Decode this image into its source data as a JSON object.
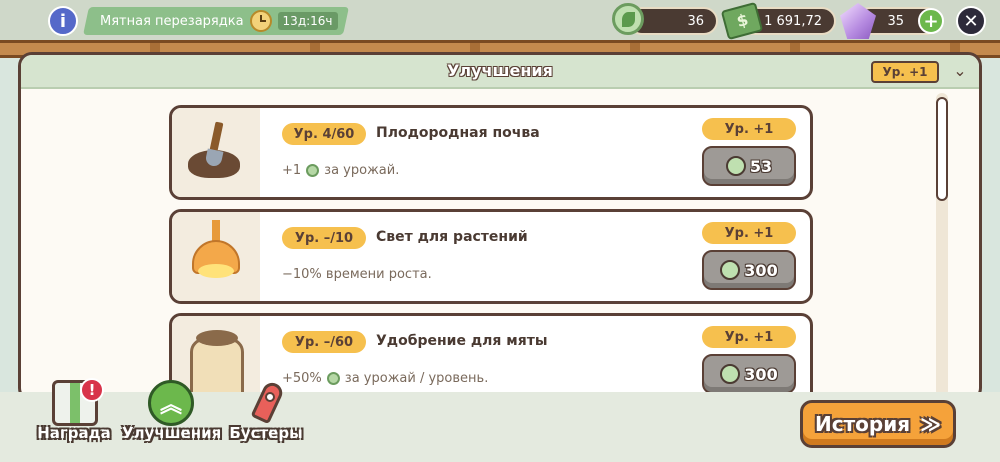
{
  "hud": {
    "timer_label": "Мятная перезарядка",
    "timer_value": "13д:16ч",
    "mint_amount": "36",
    "cash_amount": "1 691,72",
    "gems_amount": "35",
    "info_glyph": "i",
    "plus_glyph": "+",
    "close_glyph": "✕"
  },
  "panel": {
    "title": "Улучшения",
    "level_toggle": "Ур. +1",
    "collapse_glyph": "⌄"
  },
  "upgrades": [
    {
      "level": "Ур. 4/60",
      "name": "Плодородная почва",
      "desc_prefix": "+1",
      "desc_suffix": "за урожай.",
      "show_mint": true,
      "up_label": "Ур. +1",
      "cost": "53",
      "icon": "soil-shovel-icon"
    },
    {
      "level": "Ур. –/10",
      "name": "Свет для растений",
      "desc_prefix": "−10% времени роста.",
      "desc_suffix": "",
      "show_mint": false,
      "up_label": "Ур. +1",
      "cost": "300",
      "icon": "lamp-icon"
    },
    {
      "level": "Ур. –/60",
      "name": "Удобрение для мяты",
      "desc_prefix": "+50%",
      "desc_suffix": "за урожай / уровень.",
      "show_mint": true,
      "up_label": "Ур. +1",
      "cost": "300",
      "icon": "fertilizer-sack-icon"
    }
  ],
  "nav": {
    "reward_label": "Награда",
    "reward_badge": "!",
    "upgrades_label": "Улучшения",
    "upgrades_glyph": "︽",
    "boosters_label": "Бустеры"
  },
  "history_button": {
    "label": "История",
    "glyph": "≫"
  },
  "colors": {
    "accent_orange": "#f5a23a",
    "badge_yellow": "#f6c04e",
    "outline_brown": "#5a4036",
    "mint_green": "#6cb84c"
  }
}
